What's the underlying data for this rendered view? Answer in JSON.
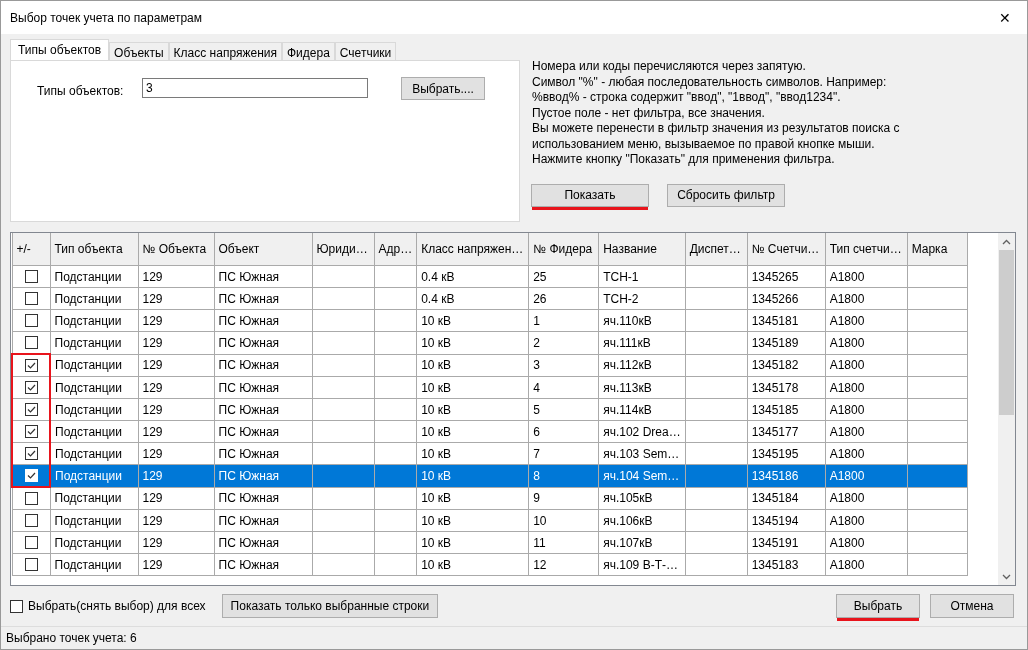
{
  "window": {
    "title": "Выбор точек учета по параметрам",
    "close": "✕"
  },
  "tabs": [
    {
      "label": "Типы объектов",
      "selected": true
    },
    {
      "label": "Объекты",
      "selected": false
    },
    {
      "label": "Класс напряжения",
      "selected": false
    },
    {
      "label": "Фидера",
      "selected": false
    },
    {
      "label": "Счетчики",
      "selected": false
    }
  ],
  "filter": {
    "label": "Типы объектов:",
    "value": "3",
    "choose_button": "Выбрать...."
  },
  "help_lines": [
    "Номера или коды перечисляются через запятую.",
    "Символ \"%\" - любая последовательность символов. Например:",
    "%ввод% - строка содержит \"ввод\", \"1ввод\", \"ввод1234\".",
    "Пустое поле - нет фильтра, все значения.",
    "Вы можете перенести в фильтр значения  из результатов поиска с",
    "использованием меню, вызываемое по правой кнопке мыши.",
    "Нажмите кнопку \"Показать\" для применения фильтра."
  ],
  "filter_buttons": [
    {
      "label": "Показать",
      "underlined": true
    },
    {
      "label": "Сбросить фильтр",
      "underlined": false
    }
  ],
  "table": {
    "columns": [
      "+/-",
      "Тип объекта",
      "№ Объекта",
      "Объект",
      "Юриди…",
      "Адр…",
      "Класс напряжен…",
      "№ Фидера",
      "Название",
      "Диспет…",
      "№ Счетчи…",
      "Тип счетчи…",
      "Марка"
    ],
    "rows": [
      {
        "checked": false,
        "selected": false,
        "marked": false,
        "cells": [
          "",
          "Подстанции",
          "129",
          "ПС Южная",
          "",
          "",
          "0.4 кВ",
          "25",
          "ТСН-1",
          "",
          "1345265",
          "A1800",
          ""
        ]
      },
      {
        "checked": false,
        "selected": false,
        "marked": false,
        "cells": [
          "",
          "Подстанции",
          "129",
          "ПС Южная",
          "",
          "",
          "0.4 кВ",
          "26",
          "ТСН-2",
          "",
          "1345266",
          "A1800",
          ""
        ]
      },
      {
        "checked": false,
        "selected": false,
        "marked": false,
        "cells": [
          "",
          "Подстанции",
          "129",
          "ПС Южная",
          "",
          "",
          "10 кВ",
          "1",
          "яч.110кВ",
          "",
          "1345181",
          "A1800",
          ""
        ]
      },
      {
        "checked": false,
        "selected": false,
        "marked": false,
        "cells": [
          "",
          "Подстанции",
          "129",
          "ПС Южная",
          "",
          "",
          "10 кВ",
          "2",
          "яч.111кВ",
          "",
          "1345189",
          "A1800",
          ""
        ]
      },
      {
        "checked": true,
        "selected": false,
        "marked": true,
        "cells": [
          "",
          "Подстанции",
          "129",
          "ПС Южная",
          "",
          "",
          "10 кВ",
          "3",
          "яч.112кВ",
          "",
          "1345182",
          "A1800",
          ""
        ]
      },
      {
        "checked": true,
        "selected": false,
        "marked": true,
        "cells": [
          "",
          "Подстанции",
          "129",
          "ПС Южная",
          "",
          "",
          "10 кВ",
          "4",
          "яч.113кВ",
          "",
          "1345178",
          "A1800",
          ""
        ]
      },
      {
        "checked": true,
        "selected": false,
        "marked": true,
        "cells": [
          "",
          "Подстанции",
          "129",
          "ПС Южная",
          "",
          "",
          "10 кВ",
          "5",
          "яч.114кВ",
          "",
          "1345185",
          "A1800",
          ""
        ]
      },
      {
        "checked": true,
        "selected": false,
        "marked": true,
        "cells": [
          "",
          "Подстанции",
          "129",
          "ПС Южная",
          "",
          "",
          "10 кВ",
          "6",
          "яч.102 Drea…",
          "",
          "1345177",
          "A1800",
          ""
        ]
      },
      {
        "checked": true,
        "selected": false,
        "marked": true,
        "cells": [
          "",
          "Подстанции",
          "129",
          "ПС Южная",
          "",
          "",
          "10 кВ",
          "7",
          "яч.103 Sem…",
          "",
          "1345195",
          "A1800",
          ""
        ]
      },
      {
        "checked": true,
        "selected": true,
        "marked": true,
        "cells": [
          "",
          "Подстанции",
          "129",
          "ПС Южная",
          "",
          "",
          "10 кВ",
          "8",
          "яч.104 Sem…",
          "",
          "1345186",
          "A1800",
          ""
        ]
      },
      {
        "checked": false,
        "selected": false,
        "marked": false,
        "cells": [
          "",
          "Подстанции",
          "129",
          "ПС Южная",
          "",
          "",
          "10 кВ",
          "9",
          "яч.105кВ",
          "",
          "1345184",
          "A1800",
          ""
        ]
      },
      {
        "checked": false,
        "selected": false,
        "marked": false,
        "cells": [
          "",
          "Подстанции",
          "129",
          "ПС Южная",
          "",
          "",
          "10 кВ",
          "10",
          "яч.106кВ",
          "",
          "1345194",
          "A1800",
          ""
        ]
      },
      {
        "checked": false,
        "selected": false,
        "marked": false,
        "cells": [
          "",
          "Подстанции",
          "129",
          "ПС Южная",
          "",
          "",
          "10 кВ",
          "11",
          "яч.107кВ",
          "",
          "1345191",
          "A1800",
          ""
        ]
      },
      {
        "checked": false,
        "selected": false,
        "marked": false,
        "cells": [
          "",
          "Подстанции",
          "129",
          "ПС Южная",
          "",
          "",
          "10 кВ",
          "12",
          "яч.109 В-Т-…",
          "",
          "1345183",
          "A1800",
          ""
        ]
      }
    ]
  },
  "select_all": {
    "label": "Выбрать(снять выбор) для всех",
    "checked": false
  },
  "show_selected_button": "Показать только выбранные строки",
  "dialog_buttons": [
    {
      "label": "Выбрать",
      "underlined": true
    },
    {
      "label": "Отмена",
      "underlined": false
    }
  ],
  "status_bar": "Выбрано точек учета: 6"
}
